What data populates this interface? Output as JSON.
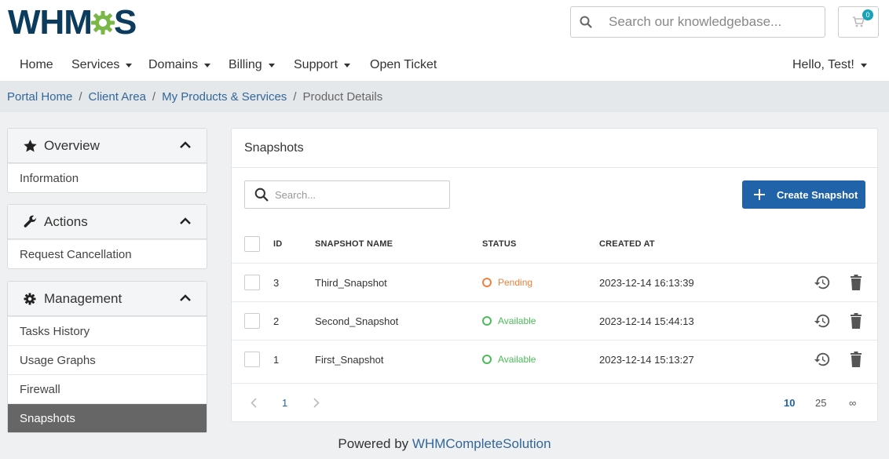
{
  "logo": {
    "text_left": "WHM",
    "text_right": "S",
    "gear_icon": "gear-icon"
  },
  "header": {
    "search_placeholder": "Search our knowledgebase...",
    "cart_count": "0"
  },
  "nav": {
    "items": [
      {
        "label": "Home",
        "dropdown": false
      },
      {
        "label": "Services",
        "dropdown": true
      },
      {
        "label": "Domains",
        "dropdown": true
      },
      {
        "label": "Billing",
        "dropdown": true
      },
      {
        "label": "Support",
        "dropdown": true
      },
      {
        "label": "Open Ticket",
        "dropdown": false
      }
    ],
    "user_label": "Hello, Test!"
  },
  "breadcrumb": {
    "items": [
      "Portal Home",
      "Client Area",
      "My Products & Services"
    ],
    "current": "Product Details"
  },
  "sidebar": {
    "overview": {
      "title": "Overview",
      "icon": "star-icon",
      "items": [
        "Information"
      ]
    },
    "actions": {
      "title": "Actions",
      "icon": "wrench-icon",
      "items": [
        "Request Cancellation"
      ]
    },
    "management": {
      "title": "Management",
      "icon": "gear-icon",
      "items": [
        "Tasks History",
        "Usage Graphs",
        "Firewall",
        "Snapshots"
      ],
      "active": "Snapshots"
    }
  },
  "snapshots": {
    "title": "Snapshots",
    "search_placeholder": "Search...",
    "create_label": "Create Snapshot",
    "columns": {
      "id": "ID",
      "name": "SNAPSHOT NAME",
      "status": "STATUS",
      "created": "CREATED AT"
    },
    "rows": [
      {
        "id": "3",
        "name": "Third_Snapshot",
        "status": "Pending",
        "created": "2023-12-14 16:13:39"
      },
      {
        "id": "2",
        "name": "Second_Snapshot",
        "status": "Available",
        "created": "2023-12-14 15:44:13"
      },
      {
        "id": "1",
        "name": "First_Snapshot",
        "status": "Available",
        "created": "2023-12-14 15:13:27"
      }
    ],
    "status_colors": {
      "Pending": "#f0803c",
      "Available": "#4cbb5a"
    },
    "pagination": {
      "current_page": "1",
      "page_sizes": [
        "10",
        "25",
        "∞"
      ],
      "selected_size": "10"
    }
  },
  "footer": {
    "prefix": "Powered by ",
    "link": "WHMCompleteSolution"
  }
}
